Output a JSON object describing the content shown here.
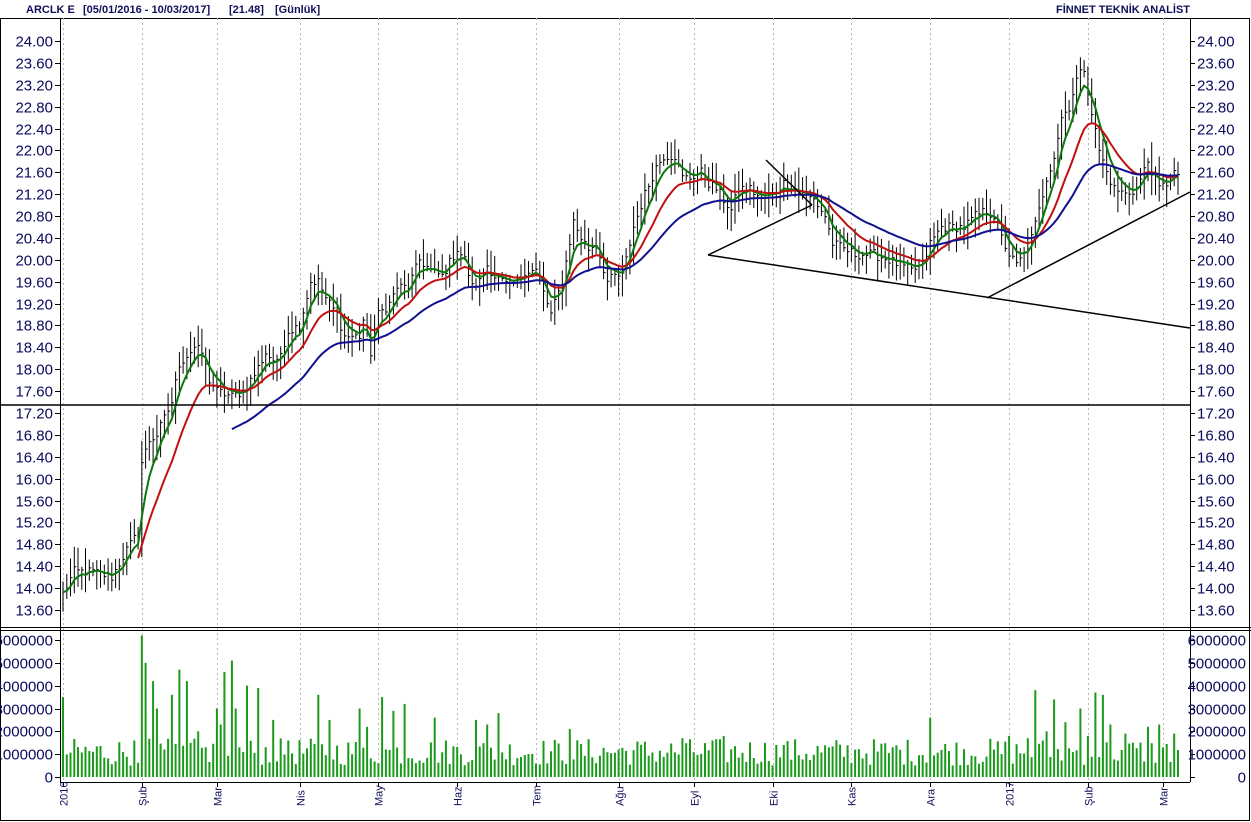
{
  "header": {
    "symbol": "ARCLK E",
    "date_range": "[05/01/2016 - 10/03/2017]",
    "last_price": "[21.48]",
    "period": "[Günlük]",
    "provider": "FİNNET TEKNİK ANALİST"
  },
  "colors": {
    "price_bars": "#000000",
    "ma_short": "#0a7a0a",
    "ma_mid": "#c01010",
    "ma_long": "#101090",
    "volume": "#1a9a1a",
    "trendlines": "#000000",
    "axis_text": "#0a0a5c"
  },
  "chart_data": [
    {
      "type": "line",
      "name": "price",
      "title": "",
      "ylim": [
        13.4,
        24.3
      ],
      "y_ticks": [
        "24.00",
        "23.60",
        "23.20",
        "22.80",
        "22.40",
        "22.00",
        "21.60",
        "21.20",
        "20.80",
        "20.40",
        "20.00",
        "19.60",
        "19.20",
        "18.80",
        "18.40",
        "18.00",
        "17.60",
        "17.20",
        "16.80",
        "16.40",
        "16.00",
        "15.60",
        "15.20",
        "14.80",
        "14.40",
        "14.00",
        "13.60"
      ],
      "x_ticks": [
        "2016",
        "Şub",
        "Mar",
        "Nis",
        "May",
        "Haz",
        "Tem",
        "Ağu",
        "Eyl",
        "Eki",
        "Kas",
        "Ara",
        "2017",
        "Şub",
        "Mar"
      ],
      "x_tick_index": [
        0,
        21,
        41,
        63,
        84,
        105,
        126,
        148,
        168,
        189,
        210,
        231,
        252,
        273,
        293
      ],
      "n_bars": 298,
      "close_keypoints": [
        [
          0,
          13.9
        ],
        [
          3,
          14.3
        ],
        [
          8,
          14.3
        ],
        [
          13,
          14.2
        ],
        [
          17,
          14.7
        ],
        [
          20,
          15.0
        ],
        [
          21,
          16.3
        ],
        [
          23,
          16.7
        ],
        [
          25,
          16.8
        ],
        [
          29,
          17.4
        ],
        [
          31,
          18.1
        ],
        [
          35,
          18.4
        ],
        [
          37,
          18.3
        ],
        [
          39,
          17.8
        ],
        [
          41,
          17.6
        ],
        [
          45,
          17.5
        ],
        [
          48,
          17.6
        ],
        [
          51,
          17.9
        ],
        [
          54,
          18.3
        ],
        [
          57,
          18.1
        ],
        [
          60,
          18.7
        ],
        [
          63,
          18.8
        ],
        [
          66,
          19.6
        ],
        [
          68,
          19.6
        ],
        [
          70,
          19.3
        ],
        [
          73,
          19.0
        ],
        [
          75,
          18.6
        ],
        [
          79,
          18.6
        ],
        [
          80,
          18.9
        ],
        [
          82,
          18.3
        ],
        [
          84,
          19.0
        ],
        [
          87,
          19.2
        ],
        [
          89,
          19.5
        ],
        [
          92,
          19.5
        ],
        [
          95,
          20.0
        ],
        [
          98,
          19.8
        ],
        [
          101,
          19.7
        ],
        [
          105,
          20.2
        ],
        [
          107,
          20.0
        ],
        [
          109,
          19.5
        ],
        [
          111,
          19.6
        ],
        [
          113,
          19.9
        ],
        [
          115,
          19.7
        ],
        [
          117,
          19.6
        ],
        [
          119,
          19.5
        ],
        [
          121,
          19.6
        ],
        [
          123,
          19.8
        ],
        [
          126,
          19.8
        ],
        [
          130,
          19.0
        ],
        [
          133,
          19.6
        ],
        [
          136,
          20.7
        ],
        [
          138,
          20.4
        ],
        [
          140,
          20.2
        ],
        [
          142,
          20.3
        ],
        [
          145,
          19.6
        ],
        [
          147,
          19.7
        ],
        [
          149,
          19.7
        ],
        [
          152,
          20.6
        ],
        [
          155,
          21.2
        ],
        [
          158,
          21.7
        ],
        [
          160,
          21.9
        ],
        [
          163,
          21.9
        ],
        [
          165,
          21.5
        ],
        [
          167,
          21.5
        ],
        [
          170,
          21.6
        ],
        [
          172,
          21.4
        ],
        [
          174,
          21.3
        ],
        [
          176,
          21.1
        ],
        [
          178,
          20.9
        ],
        [
          180,
          21.3
        ],
        [
          183,
          21.3
        ],
        [
          186,
          21.1
        ],
        [
          189,
          21.2
        ],
        [
          192,
          21.4
        ],
        [
          195,
          21.3
        ],
        [
          197,
          21.2
        ],
        [
          200,
          21.1
        ],
        [
          203,
          20.8
        ],
        [
          205,
          20.3
        ],
        [
          208,
          20.2
        ],
        [
          211,
          20.1
        ],
        [
          214,
          20.1
        ],
        [
          216,
          20.1
        ],
        [
          220,
          20.0
        ],
        [
          223,
          19.9
        ],
        [
          226,
          19.8
        ],
        [
          229,
          19.9
        ],
        [
          231,
          20.3
        ],
        [
          234,
          20.6
        ],
        [
          237,
          20.6
        ],
        [
          240,
          20.6
        ],
        [
          243,
          20.8
        ],
        [
          246,
          20.9
        ],
        [
          248,
          20.8
        ],
        [
          250,
          20.4
        ],
        [
          252,
          20.1
        ],
        [
          254,
          19.9
        ],
        [
          256,
          20.1
        ],
        [
          258,
          20.4
        ],
        [
          260,
          20.9
        ],
        [
          262,
          21.5
        ],
        [
          264,
          21.9
        ],
        [
          266,
          22.6
        ],
        [
          268,
          22.8
        ],
        [
          270,
          23.3
        ],
        [
          272,
          23.5
        ],
        [
          274,
          22.7
        ],
        [
          276,
          22.0
        ],
        [
          278,
          21.6
        ],
        [
          280,
          21.3
        ],
        [
          283,
          21.2
        ],
        [
          286,
          21.3
        ],
        [
          289,
          21.8
        ],
        [
          292,
          21.3
        ],
        [
          294,
          21.4
        ],
        [
          296,
          21.6
        ],
        [
          297,
          21.48
        ]
      ],
      "ma_start": {
        "short": 0,
        "mid": 20,
        "long": 45
      }
    },
    {
      "type": "bar",
      "name": "volume",
      "ylim": [
        0,
        6300000
      ],
      "y_ticks": [
        "6000000",
        "5000000",
        "4000000",
        "3000000",
        "2000000",
        "1000000",
        "0"
      ],
      "y_tick_values": [
        6000000,
        5000000,
        4000000,
        3000000,
        2000000,
        1000000,
        0
      ],
      "highlights": [
        [
          0,
          3500000
        ],
        [
          19,
          1600000
        ],
        [
          21,
          6200000
        ],
        [
          22,
          5000000
        ],
        [
          24,
          4200000
        ],
        [
          25,
          3000000
        ],
        [
          29,
          3600000
        ],
        [
          31,
          4700000
        ],
        [
          33,
          4200000
        ],
        [
          36,
          2000000
        ],
        [
          41,
          3000000
        ],
        [
          42,
          2300000
        ],
        [
          43,
          4600000
        ],
        [
          45,
          5100000
        ],
        [
          46,
          3000000
        ],
        [
          49,
          4000000
        ],
        [
          52,
          3900000
        ],
        [
          56,
          2500000
        ],
        [
          60,
          1600000
        ],
        [
          68,
          3600000
        ],
        [
          71,
          2500000
        ],
        [
          79,
          3000000
        ],
        [
          81,
          2200000
        ],
        [
          85,
          3500000
        ],
        [
          88,
          2900000
        ],
        [
          91,
          3200000
        ],
        [
          99,
          2600000
        ],
        [
          110,
          2500000
        ],
        [
          113,
          2300000
        ],
        [
          116,
          2800000
        ],
        [
          135,
          2100000
        ],
        [
          148,
          1200000
        ],
        [
          165,
          1700000
        ],
        [
          176,
          1800000
        ],
        [
          192,
          1400000
        ],
        [
          211,
          1200000
        ],
        [
          221,
          1300000
        ],
        [
          231,
          2600000
        ],
        [
          252,
          1800000
        ],
        [
          257,
          1700000
        ],
        [
          259,
          3800000
        ],
        [
          262,
          2000000
        ],
        [
          264,
          3400000
        ],
        [
          267,
          2400000
        ],
        [
          271,
          3000000
        ],
        [
          273,
          1800000
        ],
        [
          275,
          3700000
        ],
        [
          277,
          3600000
        ],
        [
          279,
          2300000
        ],
        [
          283,
          1900000
        ],
        [
          289,
          2200000
        ],
        [
          292,
          2300000
        ],
        [
          296,
          1900000
        ]
      ]
    }
  ]
}
